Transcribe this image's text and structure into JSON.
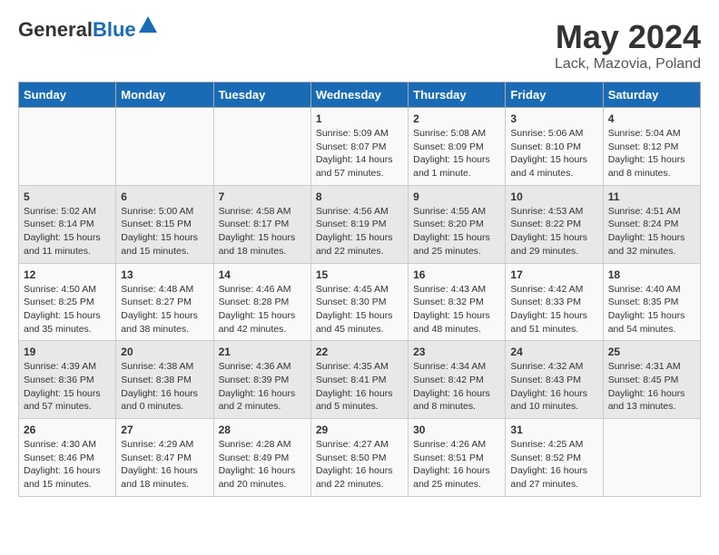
{
  "header": {
    "logo_general": "General",
    "logo_blue": "Blue",
    "month_title": "May 2024",
    "location": "Lack, Mazovia, Poland"
  },
  "days_of_week": [
    "Sunday",
    "Monday",
    "Tuesday",
    "Wednesday",
    "Thursday",
    "Friday",
    "Saturday"
  ],
  "weeks": [
    [
      {
        "day": "",
        "info": ""
      },
      {
        "day": "",
        "info": ""
      },
      {
        "day": "",
        "info": ""
      },
      {
        "day": "1",
        "info": "Sunrise: 5:09 AM\nSunset: 8:07 PM\nDaylight: 14 hours\nand 57 minutes."
      },
      {
        "day": "2",
        "info": "Sunrise: 5:08 AM\nSunset: 8:09 PM\nDaylight: 15 hours\nand 1 minute."
      },
      {
        "day": "3",
        "info": "Sunrise: 5:06 AM\nSunset: 8:10 PM\nDaylight: 15 hours\nand 4 minutes."
      },
      {
        "day": "4",
        "info": "Sunrise: 5:04 AM\nSunset: 8:12 PM\nDaylight: 15 hours\nand 8 minutes."
      }
    ],
    [
      {
        "day": "5",
        "info": "Sunrise: 5:02 AM\nSunset: 8:14 PM\nDaylight: 15 hours\nand 11 minutes."
      },
      {
        "day": "6",
        "info": "Sunrise: 5:00 AM\nSunset: 8:15 PM\nDaylight: 15 hours\nand 15 minutes."
      },
      {
        "day": "7",
        "info": "Sunrise: 4:58 AM\nSunset: 8:17 PM\nDaylight: 15 hours\nand 18 minutes."
      },
      {
        "day": "8",
        "info": "Sunrise: 4:56 AM\nSunset: 8:19 PM\nDaylight: 15 hours\nand 22 minutes."
      },
      {
        "day": "9",
        "info": "Sunrise: 4:55 AM\nSunset: 8:20 PM\nDaylight: 15 hours\nand 25 minutes."
      },
      {
        "day": "10",
        "info": "Sunrise: 4:53 AM\nSunset: 8:22 PM\nDaylight: 15 hours\nand 29 minutes."
      },
      {
        "day": "11",
        "info": "Sunrise: 4:51 AM\nSunset: 8:24 PM\nDaylight: 15 hours\nand 32 minutes."
      }
    ],
    [
      {
        "day": "12",
        "info": "Sunrise: 4:50 AM\nSunset: 8:25 PM\nDaylight: 15 hours\nand 35 minutes."
      },
      {
        "day": "13",
        "info": "Sunrise: 4:48 AM\nSunset: 8:27 PM\nDaylight: 15 hours\nand 38 minutes."
      },
      {
        "day": "14",
        "info": "Sunrise: 4:46 AM\nSunset: 8:28 PM\nDaylight: 15 hours\nand 42 minutes."
      },
      {
        "day": "15",
        "info": "Sunrise: 4:45 AM\nSunset: 8:30 PM\nDaylight: 15 hours\nand 45 minutes."
      },
      {
        "day": "16",
        "info": "Sunrise: 4:43 AM\nSunset: 8:32 PM\nDaylight: 15 hours\nand 48 minutes."
      },
      {
        "day": "17",
        "info": "Sunrise: 4:42 AM\nSunset: 8:33 PM\nDaylight: 15 hours\nand 51 minutes."
      },
      {
        "day": "18",
        "info": "Sunrise: 4:40 AM\nSunset: 8:35 PM\nDaylight: 15 hours\nand 54 minutes."
      }
    ],
    [
      {
        "day": "19",
        "info": "Sunrise: 4:39 AM\nSunset: 8:36 PM\nDaylight: 15 hours\nand 57 minutes."
      },
      {
        "day": "20",
        "info": "Sunrise: 4:38 AM\nSunset: 8:38 PM\nDaylight: 16 hours\nand 0 minutes."
      },
      {
        "day": "21",
        "info": "Sunrise: 4:36 AM\nSunset: 8:39 PM\nDaylight: 16 hours\nand 2 minutes."
      },
      {
        "day": "22",
        "info": "Sunrise: 4:35 AM\nSunset: 8:41 PM\nDaylight: 16 hours\nand 5 minutes."
      },
      {
        "day": "23",
        "info": "Sunrise: 4:34 AM\nSunset: 8:42 PM\nDaylight: 16 hours\nand 8 minutes."
      },
      {
        "day": "24",
        "info": "Sunrise: 4:32 AM\nSunset: 8:43 PM\nDaylight: 16 hours\nand 10 minutes."
      },
      {
        "day": "25",
        "info": "Sunrise: 4:31 AM\nSunset: 8:45 PM\nDaylight: 16 hours\nand 13 minutes."
      }
    ],
    [
      {
        "day": "26",
        "info": "Sunrise: 4:30 AM\nSunset: 8:46 PM\nDaylight: 16 hours\nand 15 minutes."
      },
      {
        "day": "27",
        "info": "Sunrise: 4:29 AM\nSunset: 8:47 PM\nDaylight: 16 hours\nand 18 minutes."
      },
      {
        "day": "28",
        "info": "Sunrise: 4:28 AM\nSunset: 8:49 PM\nDaylight: 16 hours\nand 20 minutes."
      },
      {
        "day": "29",
        "info": "Sunrise: 4:27 AM\nSunset: 8:50 PM\nDaylight: 16 hours\nand 22 minutes."
      },
      {
        "day": "30",
        "info": "Sunrise: 4:26 AM\nSunset: 8:51 PM\nDaylight: 16 hours\nand 25 minutes."
      },
      {
        "day": "31",
        "info": "Sunrise: 4:25 AM\nSunset: 8:52 PM\nDaylight: 16 hours\nand 27 minutes."
      },
      {
        "day": "",
        "info": ""
      }
    ]
  ]
}
